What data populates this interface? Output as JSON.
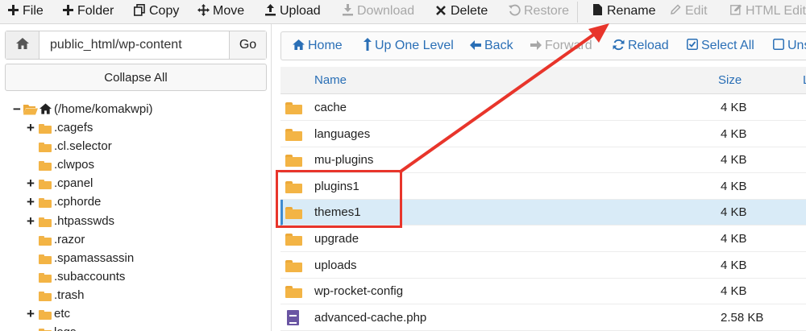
{
  "toolbar": {
    "buttons": [
      {
        "label": "File",
        "icon": "plus-icon",
        "disabled": false
      },
      {
        "label": "Folder",
        "icon": "plus-icon",
        "disabled": false
      },
      {
        "label": "Copy",
        "icon": "copy-icon",
        "disabled": false
      },
      {
        "label": "Move",
        "icon": "move-icon",
        "disabled": false
      },
      {
        "label": "Upload",
        "icon": "upload-icon",
        "disabled": false
      },
      {
        "label": "Download",
        "icon": "download-icon",
        "disabled": true
      },
      {
        "label": "Delete",
        "icon": "close-icon",
        "disabled": false
      },
      {
        "label": "Restore",
        "icon": "restore-icon",
        "disabled": true
      },
      {
        "label": "Rename",
        "icon": "file-icon",
        "disabled": false
      },
      {
        "label": "Edit",
        "icon": "pencil-icon",
        "disabled": true
      },
      {
        "label": "HTML Edito",
        "icon": "html-edit-icon",
        "disabled": true
      }
    ]
  },
  "address_bar": {
    "value": "public_html/wp-content",
    "go_label": "Go"
  },
  "collapse_label": "Collapse All",
  "tree": {
    "root_label": "(/home/komakwpi)",
    "items": [
      {
        "label": ".cagefs",
        "expandable": true
      },
      {
        "label": ".cl.selector",
        "expandable": false
      },
      {
        "label": ".clwpos",
        "expandable": false
      },
      {
        "label": ".cpanel",
        "expandable": true
      },
      {
        "label": ".cphorde",
        "expandable": true
      },
      {
        "label": ".htpasswds",
        "expandable": true
      },
      {
        "label": ".razor",
        "expandable": false
      },
      {
        "label": ".spamassassin",
        "expandable": false
      },
      {
        "label": ".subaccounts",
        "expandable": false
      },
      {
        "label": ".trash",
        "expandable": false
      },
      {
        "label": "etc",
        "expandable": true
      },
      {
        "label": "logs",
        "expandable": false
      }
    ]
  },
  "nav": {
    "buttons": [
      {
        "label": "Home",
        "icon": "home-icon",
        "disabled": false
      },
      {
        "label": "Up One Level",
        "icon": "up-arrow-icon",
        "disabled": false
      },
      {
        "label": "Back",
        "icon": "back-arrow-icon",
        "disabled": false
      },
      {
        "label": "Forward",
        "icon": "forward-arrow-icon",
        "disabled": true
      },
      {
        "label": "Reload",
        "icon": "reload-icon",
        "disabled": false
      },
      {
        "label": "Select All",
        "icon": "checkbox-checked-icon",
        "disabled": false
      },
      {
        "label": "Uns",
        "icon": "checkbox-icon",
        "disabled": false
      }
    ]
  },
  "table": {
    "headers": {
      "name": "Name",
      "size": "Size",
      "extra": "L"
    },
    "rows": [
      {
        "name": "cache",
        "size": "4 KB",
        "type": "folder",
        "selected": false
      },
      {
        "name": "languages",
        "size": "4 KB",
        "type": "folder",
        "selected": false
      },
      {
        "name": "mu-plugins",
        "size": "4 KB",
        "type": "folder",
        "selected": false
      },
      {
        "name": "plugins1",
        "size": "4 KB",
        "type": "folder",
        "selected": false
      },
      {
        "name": "themes1",
        "size": "4 KB",
        "type": "folder",
        "selected": true
      },
      {
        "name": "upgrade",
        "size": "4 KB",
        "type": "folder",
        "selected": false
      },
      {
        "name": "uploads",
        "size": "4 KB",
        "type": "folder",
        "selected": false
      },
      {
        "name": "wp-rocket-config",
        "size": "4 KB",
        "type": "folder",
        "selected": false
      },
      {
        "name": "advanced-cache.php",
        "size": "2.58 KB",
        "type": "php-file",
        "selected": false
      }
    ]
  },
  "colors": {
    "link_blue": "#2a6fb6",
    "folder_orange": "#f3b445",
    "selected_row": "#d9ebf7",
    "annotation_red": "#e8352b"
  }
}
